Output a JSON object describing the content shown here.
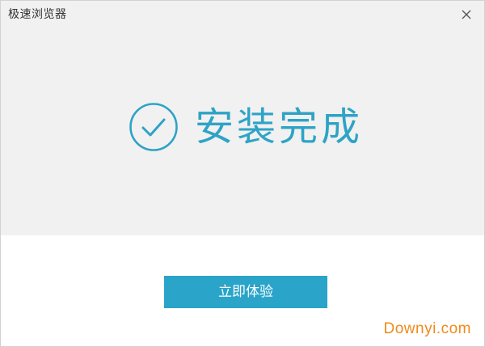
{
  "window": {
    "title": "极速浏览器"
  },
  "status": {
    "icon": "check-circle-icon",
    "text": "安装完成"
  },
  "actions": {
    "primary_label": "立即体验"
  },
  "watermark": {
    "text": "Downyi.com"
  },
  "colors": {
    "accent": "#2ea3c6",
    "button": "#2aa4c9",
    "panel": "#f1f1f1",
    "watermark": "#f08a1c"
  }
}
